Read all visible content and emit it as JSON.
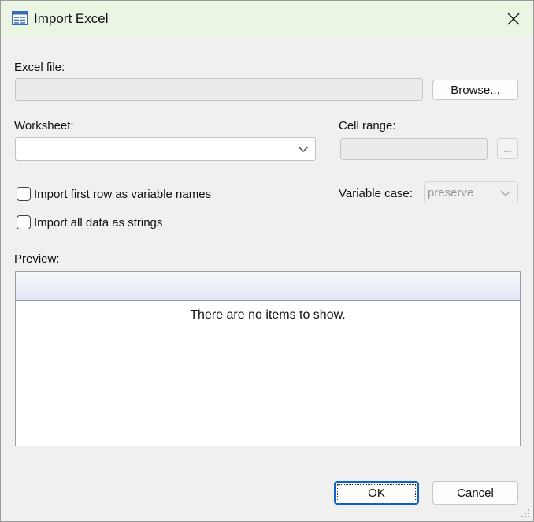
{
  "window": {
    "title": "Import Excel",
    "icon": "table-window-icon",
    "close_icon": "close-icon"
  },
  "excel_file": {
    "label": "Excel file:",
    "value": "",
    "browse_label": "Browse..."
  },
  "worksheet": {
    "label": "Worksheet:",
    "value": ""
  },
  "cell_range": {
    "label": "Cell range:",
    "value": "",
    "ellipsis_label": "..."
  },
  "options": {
    "first_row_label": "Import first row as variable names",
    "first_row_checked": false,
    "all_strings_label": "Import all data as strings",
    "all_strings_checked": false
  },
  "variable_case": {
    "label": "Variable case:",
    "value": "preserve"
  },
  "preview": {
    "label": "Preview:",
    "empty_message": "There are no items to show."
  },
  "footer": {
    "ok_label": "OK",
    "cancel_label": "Cancel"
  }
}
